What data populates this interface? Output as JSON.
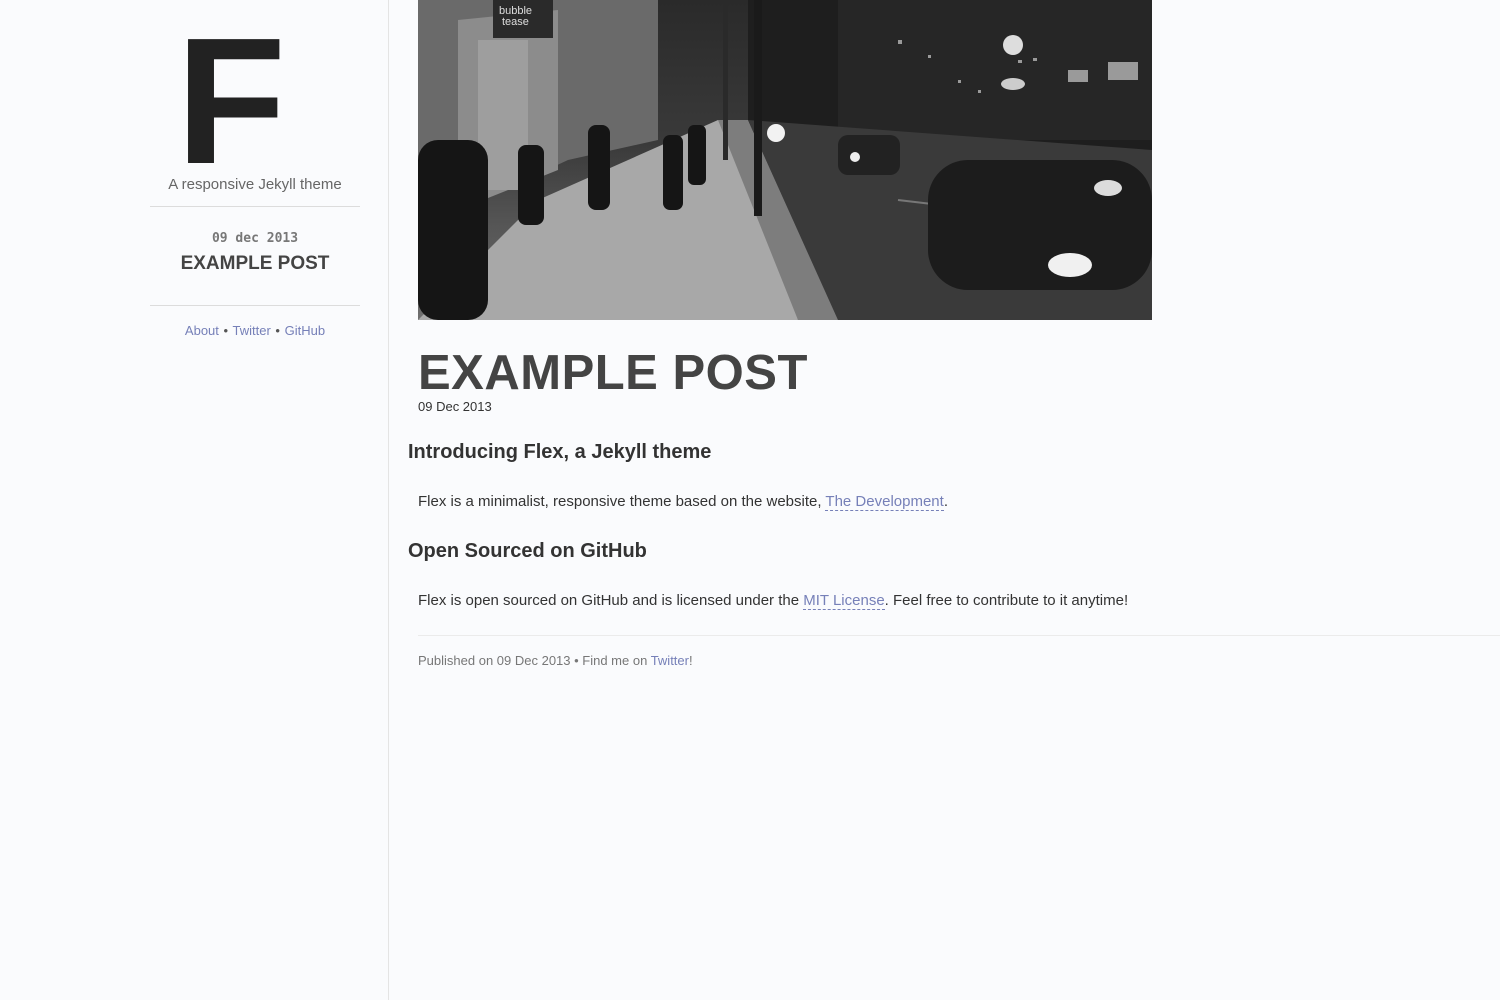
{
  "sidebar": {
    "logo_letter": "F",
    "tagline": "A responsive Jekyll theme",
    "post_date": "09 dec 2013",
    "post_title": "EXAMPLE POST",
    "nav": [
      {
        "label": "About"
      },
      {
        "label": "Twitter"
      },
      {
        "label": "GitHub"
      }
    ],
    "separator": "•"
  },
  "hero": {
    "sign_text_1": "bubble",
    "sign_text_2": "tease"
  },
  "post": {
    "title": "EXAMPLE POST",
    "date": "09 Dec 2013",
    "sections": [
      {
        "heading": "Introducing Flex, a Jekyll theme",
        "text_before": "Flex is a minimalist, responsive theme based on the website, ",
        "link": "The Development",
        "text_after": "."
      },
      {
        "heading": "Open Sourced on GitHub",
        "text_before": "Flex is open sourced on GitHub and is licensed under the ",
        "link": "MIT License",
        "text_after": ". Feel free to contribute to it anytime!"
      }
    ]
  },
  "footer": {
    "published_prefix": "Published on 09 Dec 2013 • Find me on ",
    "twitter_link": "Twitter",
    "suffix": "!"
  },
  "colors": {
    "link": "#7680b8",
    "background": "#fafbfd",
    "heading": "#444444"
  }
}
